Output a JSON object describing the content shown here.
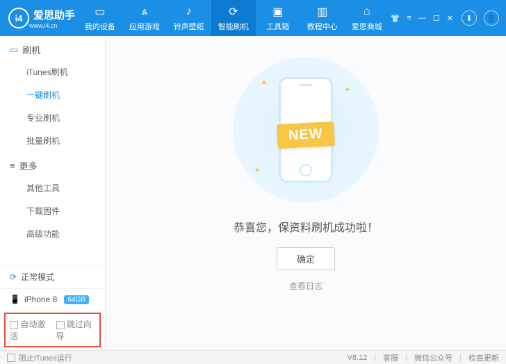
{
  "brand": {
    "logo_text": "爱思助手",
    "logo_sub": "www.i4.cn",
    "logo_badge": "i4"
  },
  "nav": [
    {
      "icon": "▭",
      "label": "我的设备"
    },
    {
      "icon": "⩓",
      "label": "应用游戏"
    },
    {
      "icon": "♪",
      "label": "铃声壁纸"
    },
    {
      "icon": "⟳",
      "label": "智能刷机",
      "active": true
    },
    {
      "icon": "▣",
      "label": "工具箱"
    },
    {
      "icon": "▥",
      "label": "教程中心"
    },
    {
      "icon": "⌂",
      "label": "爱思商城"
    }
  ],
  "win": {
    "download_icon": "⬇",
    "user_icon": "👤"
  },
  "sidebar": {
    "group1": {
      "title": "刷机",
      "icon": "▭"
    },
    "items1": [
      "iTunes刷机",
      "一键刷机",
      "专业刷机",
      "批量刷机"
    ],
    "group2": {
      "title": "更多",
      "icon": "≡"
    },
    "items2": [
      "其他工具",
      "下载固件",
      "高级功能"
    ],
    "status": "正常模式",
    "device": {
      "name": "iPhone 8",
      "badge": "64GB"
    },
    "opts": {
      "auto": "自动激活",
      "skip": "跳过向导"
    }
  },
  "main": {
    "ribbon": "NEW",
    "message": "恭喜您，保资料刷机成功啦！",
    "ok": "确定",
    "log": "查看日志"
  },
  "footer": {
    "block_itunes": "阻止iTunes运行",
    "version": "V8.12",
    "support": "客服",
    "wechat": "微信公众号",
    "update": "检查更新"
  }
}
